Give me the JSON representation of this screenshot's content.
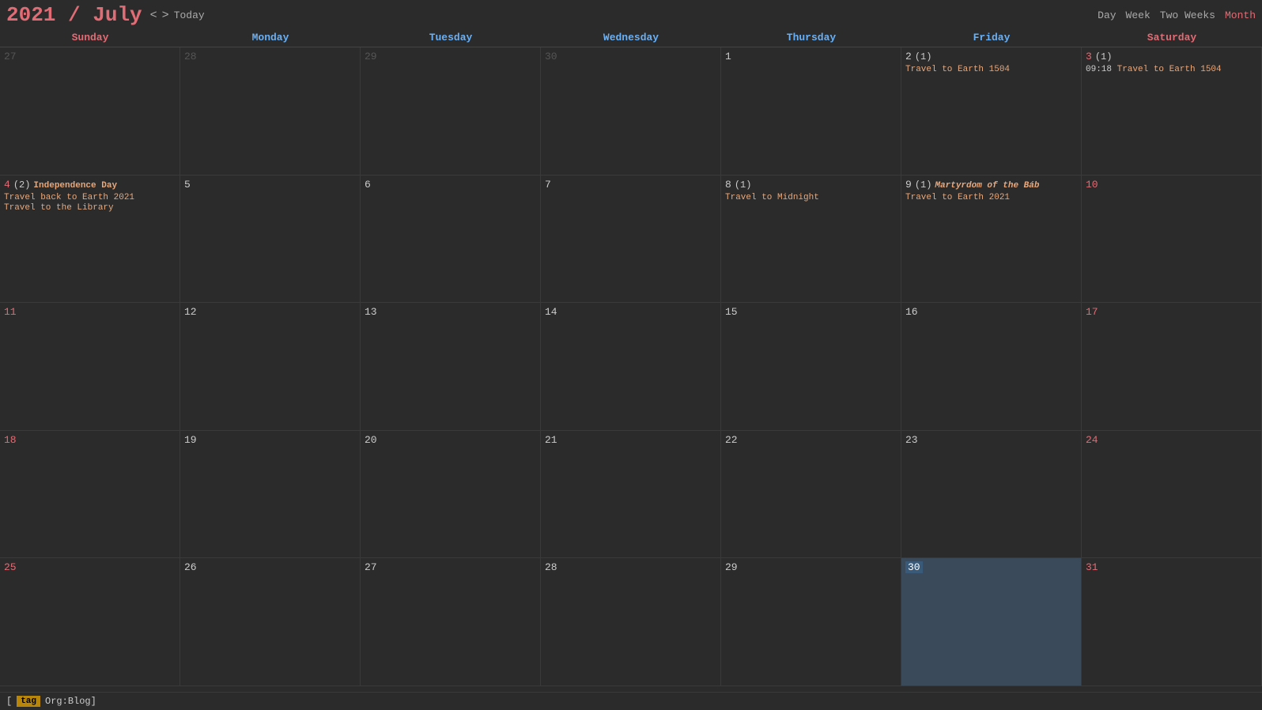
{
  "header": {
    "year": "2021",
    "separator": " / ",
    "month": "July",
    "prev_label": "<",
    "next_label": ">",
    "today_label": "Today"
  },
  "views": {
    "day": "Day",
    "week": "Week",
    "two_weeks": "Two Weeks",
    "month": "Month"
  },
  "day_headers": [
    {
      "label": "Sunday",
      "type": "weekend"
    },
    {
      "label": "Monday",
      "type": "weekday"
    },
    {
      "label": "Tuesday",
      "type": "weekday"
    },
    {
      "label": "Wednesday",
      "type": "weekday"
    },
    {
      "label": "Thursday",
      "type": "weekday"
    },
    {
      "label": "Friday",
      "type": "weekday"
    },
    {
      "label": "Saturday",
      "type": "weekend"
    }
  ],
  "weeks": [
    {
      "days": [
        {
          "date": "27",
          "other": true,
          "weekend": true,
          "events": []
        },
        {
          "date": "28",
          "other": true,
          "weekend": false,
          "events": []
        },
        {
          "date": "29",
          "other": true,
          "weekend": false,
          "events": []
        },
        {
          "date": "30",
          "other": true,
          "weekend": false,
          "events": []
        },
        {
          "date": "1",
          "other": false,
          "weekend": false,
          "events": []
        },
        {
          "date": "2",
          "other": false,
          "weekend": false,
          "count": 1,
          "events": [
            {
              "text": "Travel to Earth 1504",
              "type": "travel"
            }
          ]
        },
        {
          "date": "3",
          "other": false,
          "weekend": true,
          "count": 1,
          "events": [
            {
              "time": "09:18",
              "text": "Travel to Earth 1504",
              "type": "travel"
            }
          ]
        }
      ]
    },
    {
      "days": [
        {
          "date": "4",
          "other": false,
          "weekend": true,
          "count": 2,
          "events": [
            {
              "text": "Independence Day",
              "type": "holiday"
            },
            {
              "text": "Travel back to Earth 2021",
              "type": "travel"
            },
            {
              "text": "Travel to the Library",
              "type": "travel"
            }
          ]
        },
        {
          "date": "5",
          "other": false,
          "weekend": false,
          "events": []
        },
        {
          "date": "6",
          "other": false,
          "weekend": false,
          "events": []
        },
        {
          "date": "7",
          "other": false,
          "weekend": false,
          "events": []
        },
        {
          "date": "8",
          "other": false,
          "weekend": false,
          "count": 1,
          "events": [
            {
              "text": "Travel to Midnight",
              "type": "travel"
            }
          ]
        },
        {
          "date": "9",
          "other": false,
          "weekend": false,
          "count": 1,
          "events": [
            {
              "text": "Martyrdom of the Báb",
              "type": "martyrdom"
            },
            {
              "text": "Travel to Earth 2021",
              "type": "travel"
            }
          ]
        },
        {
          "date": "10",
          "other": false,
          "weekend": true,
          "events": []
        }
      ]
    },
    {
      "days": [
        {
          "date": "11",
          "other": false,
          "weekend": true,
          "events": []
        },
        {
          "date": "12",
          "other": false,
          "weekend": false,
          "events": []
        },
        {
          "date": "13",
          "other": false,
          "weekend": false,
          "events": []
        },
        {
          "date": "14",
          "other": false,
          "weekend": false,
          "events": []
        },
        {
          "date": "15",
          "other": false,
          "weekend": false,
          "events": []
        },
        {
          "date": "16",
          "other": false,
          "weekend": false,
          "events": []
        },
        {
          "date": "17",
          "other": false,
          "weekend": true,
          "events": []
        }
      ]
    },
    {
      "days": [
        {
          "date": "18",
          "other": false,
          "weekend": true,
          "events": []
        },
        {
          "date": "19",
          "other": false,
          "weekend": false,
          "events": []
        },
        {
          "date": "20",
          "other": false,
          "weekend": false,
          "events": []
        },
        {
          "date": "21",
          "other": false,
          "weekend": false,
          "events": []
        },
        {
          "date": "22",
          "other": false,
          "weekend": false,
          "events": []
        },
        {
          "date": "23",
          "other": false,
          "weekend": false,
          "events": []
        },
        {
          "date": "24",
          "other": false,
          "weekend": true,
          "events": []
        }
      ]
    },
    {
      "days": [
        {
          "date": "25",
          "other": false,
          "weekend": true,
          "events": []
        },
        {
          "date": "26",
          "other": false,
          "weekend": false,
          "events": []
        },
        {
          "date": "27",
          "other": false,
          "weekend": false,
          "events": []
        },
        {
          "date": "28",
          "other": false,
          "weekend": false,
          "events": []
        },
        {
          "date": "29",
          "other": false,
          "weekend": false,
          "events": []
        },
        {
          "date": "30",
          "other": false,
          "weekend": false,
          "today": true,
          "events": []
        },
        {
          "date": "31",
          "other": false,
          "weekend": true,
          "events": []
        }
      ]
    }
  ],
  "bottom_bar": {
    "bracket_open": "[",
    "tag_label": "tag",
    "org_text": "Org:Blog]"
  }
}
